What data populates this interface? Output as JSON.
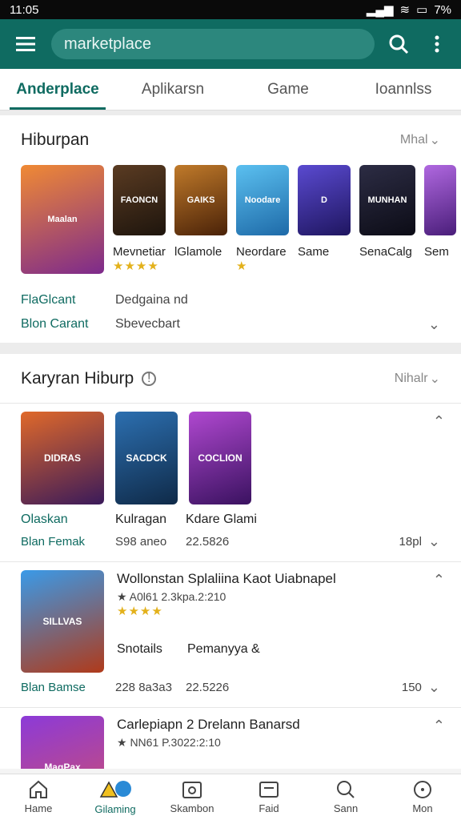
{
  "status": {
    "time": "11:05",
    "battery": "7%"
  },
  "appbar": {
    "search_value": "marketplace"
  },
  "tabs": [
    {
      "label": "Anderplace",
      "active": true
    },
    {
      "label": "Aplikarsn",
      "active": false
    },
    {
      "label": "Game",
      "active": false
    },
    {
      "label": "Ioannlss",
      "active": false
    }
  ],
  "section1": {
    "title": "Hiburpan",
    "more": "Mhal",
    "apps": [
      {
        "name": "",
        "stars": "",
        "art": "Maalan",
        "color": "#d9652b"
      },
      {
        "name": "Mevnetiar",
        "stars": "★★★★",
        "art": "FAONCN",
        "color": "#3a2a1d"
      },
      {
        "name": "lGlamole",
        "stars": "",
        "art": "GAIKS",
        "color": "#8a4a12"
      },
      {
        "name": "Neordare",
        "stars": "★",
        "art": "Noodare",
        "color": "#2e9ad6"
      },
      {
        "name": "Same",
        "stars": "",
        "art": "D",
        "color": "#3b2a8e"
      },
      {
        "name": "SenaCalg",
        "stars": "",
        "art": "MUNHAN",
        "color": "#1c1c2e"
      },
      {
        "name": "Sem",
        "stars": "",
        "art": "",
        "color": "#8a3fc2"
      }
    ],
    "rows": [
      {
        "k": "FlaGlcant",
        "v": "Dedgaina nd"
      },
      {
        "k": "Blon Carant",
        "v": "Sbevecbart"
      }
    ]
  },
  "section2": {
    "title": "Karyran Hiburp",
    "more": "Nihalr",
    "group1": {
      "tiles": [
        {
          "art": "DIDRAS",
          "color": "#a23b1e"
        },
        {
          "art": "SACDCK",
          "color": "#1d4c7a"
        },
        {
          "art": "COCLION",
          "color": "#8c2ea8"
        }
      ],
      "labels": [
        "Olaskan",
        "Kulragan",
        "Kdare Glami"
      ],
      "sub_teal": "Blan Femak",
      "sub": [
        "S98 aneo",
        "22.5826"
      ],
      "right": "18pl"
    },
    "group2": {
      "tile": {
        "art": "SILLVAS",
        "color": "#2a7ad3"
      },
      "title": "Wollonstan Splaliina Kaot Uiabnapel",
      "rating_text": "★ A0l61 2.3kpa.2:210",
      "stars": "★★★★",
      "labels": [
        "Snotails",
        "Pemanyya &"
      ],
      "sub_teal": "Blan Bamse",
      "sub": [
        "228 8a3a3",
        "22.5226"
      ],
      "right": "150"
    },
    "group3": {
      "tile": {
        "art": "MagPax",
        "color": "#7a2fb0"
      },
      "title": "Carlepiapn 2 Drelann Banarsd",
      "rating_text": "★ NN61 P.3022:2:10"
    }
  },
  "bottomnav": [
    {
      "label": "Hame",
      "icon": "home-icon",
      "active": false
    },
    {
      "label": "Gilaming",
      "icon": "gaming-icon",
      "active": true
    },
    {
      "label": "Skambon",
      "icon": "store-icon",
      "active": false
    },
    {
      "label": "Faid",
      "icon": "feed-icon",
      "active": false
    },
    {
      "label": "Sann",
      "icon": "search-icon",
      "active": false
    },
    {
      "label": "Mon",
      "icon": "more-icon",
      "active": false
    }
  ]
}
